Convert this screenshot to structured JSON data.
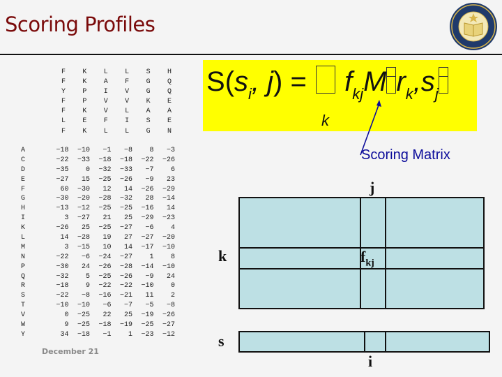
{
  "slide": {
    "title": "Scoring Profiles",
    "footer_date": "December 21",
    "logo": "uc-san-diego-seal-icon",
    "colors": {
      "title": "#7a0a0a",
      "formula_bg": "#ffff00",
      "annotation": "#0b0b9a",
      "matrix_fill": "#bde0e4"
    }
  },
  "alignment": {
    "columns": [
      [
        "F",
        "F",
        "Y",
        "F",
        "F",
        "L",
        "F"
      ],
      [
        "K",
        "K",
        "P",
        "P",
        "K",
        "E",
        "K"
      ],
      [
        "L",
        "A",
        "I",
        "V",
        "V",
        "F",
        "L"
      ],
      [
        "L",
        "F",
        "V",
        "V",
        "L",
        "I",
        "L"
      ],
      [
        "S",
        "G",
        "G",
        "K",
        "A",
        "S",
        "G"
      ],
      [
        "H",
        "Q",
        "Q",
        "E",
        "A",
        "E",
        "N"
      ]
    ]
  },
  "profile": {
    "rows": [
      {
        "aa": "A",
        "values": [
          -18,
          -10,
          -1,
          -8,
          8,
          -3
        ]
      },
      {
        "aa": "C",
        "values": [
          -22,
          -33,
          -18,
          -18,
          -22,
          -26
        ]
      },
      {
        "aa": "D",
        "values": [
          -35,
          0,
          -32,
          -33,
          -7,
          6
        ]
      },
      {
        "aa": "E",
        "values": [
          -27,
          15,
          -25,
          -26,
          -9,
          23
        ]
      },
      {
        "aa": "F",
        "values": [
          60,
          -30,
          12,
          14,
          -26,
          -29
        ]
      },
      {
        "aa": "G",
        "values": [
          -30,
          -20,
          -28,
          -32,
          28,
          -14
        ]
      },
      {
        "aa": "H",
        "values": [
          -13,
          -12,
          -25,
          -25,
          -16,
          14
        ]
      },
      {
        "aa": "I",
        "values": [
          3,
          -27,
          21,
          25,
          -29,
          -23
        ]
      },
      {
        "aa": "K",
        "values": [
          -26,
          25,
          -25,
          -27,
          -6,
          4
        ]
      },
      {
        "aa": "L",
        "values": [
          14,
          -28,
          19,
          27,
          -27,
          -20
        ]
      },
      {
        "aa": "M",
        "values": [
          3,
          -15,
          10,
          14,
          -17,
          -10
        ]
      },
      {
        "aa": "N",
        "values": [
          -22,
          -6,
          -24,
          -27,
          1,
          8
        ]
      },
      {
        "aa": "P",
        "values": [
          -30,
          24,
          -26,
          -28,
          -14,
          -10
        ]
      },
      {
        "aa": "Q",
        "values": [
          -32,
          5,
          -25,
          -26,
          -9,
          24
        ]
      },
      {
        "aa": "R",
        "values": [
          -18,
          9,
          -22,
          -22,
          -10,
          0
        ]
      },
      {
        "aa": "S",
        "values": [
          -22,
          -8,
          -16,
          -21,
          11,
          2
        ]
      },
      {
        "aa": "T",
        "values": [
          -10,
          -10,
          -6,
          -7,
          -5,
          -8
        ]
      },
      {
        "aa": "V",
        "values": [
          0,
          -25,
          22,
          25,
          -19,
          -26
        ]
      },
      {
        "aa": "W",
        "values": [
          9,
          -25,
          -18,
          -19,
          -25,
          -27
        ]
      },
      {
        "aa": "Y",
        "values": [
          34,
          -18,
          -1,
          1,
          -23,
          -12
        ]
      }
    ]
  },
  "formula": {
    "S": "S",
    "open": "(",
    "s": "s",
    "sub_i": "i",
    "comma_j": ", j",
    "close": ")",
    "eq": "=",
    "f": "f",
    "sub_kj": "kj",
    "M": "M",
    "r": "r",
    "sub_k": "k",
    "comma": ",",
    "s2": "s",
    "sub_j": "j",
    "sum_index": "k"
  },
  "annotation": {
    "label": "Scoring Matrix"
  },
  "diagram": {
    "col_label": "j",
    "row_label": "k",
    "cell_label": "f",
    "cell_sub": "kj",
    "seq_label": "s",
    "pos_label": "i"
  }
}
